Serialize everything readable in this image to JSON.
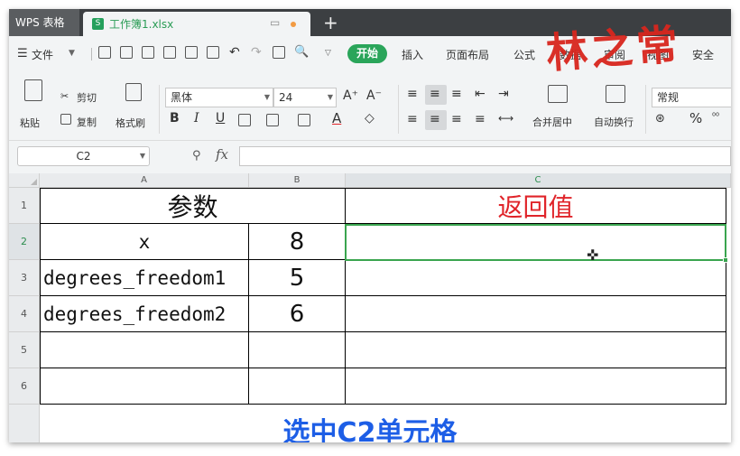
{
  "tabbar": {
    "app_label": "WPS 表格",
    "file_name": "工作簿1.xlsx",
    "plus": "+"
  },
  "menubar": {
    "file": "文件",
    "tabs": [
      "开始",
      "插入",
      "页面布局",
      "公式",
      "数据",
      "审阅",
      "视图",
      "安全"
    ]
  },
  "ribbon": {
    "paste": "粘贴",
    "cut": "剪切",
    "copy": "复制",
    "format_painter": "格式刷",
    "font_name": "黑体",
    "font_size": "24",
    "bold": "B",
    "italic": "I",
    "underline": "U",
    "grow_font": "A⁺",
    "shrink_font": "A⁻",
    "merge_center": "合并居中",
    "wrap_text": "自动换行",
    "number_format": "常规",
    "percent": "%"
  },
  "formula_bar": {
    "name_box": "C2",
    "fx": "fx",
    "formula": ""
  },
  "grid": {
    "columns": [
      "A",
      "B",
      "C"
    ],
    "rows": [
      "1",
      "2",
      "3",
      "4",
      "5",
      "6"
    ],
    "header_param": "参数",
    "header_return": "返回值",
    "rows_data": [
      {
        "label": "x",
        "value": "8"
      },
      {
        "label": "degrees_freedom1",
        "value": "5"
      },
      {
        "label": "degrees_freedom2",
        "value": "6"
      }
    ],
    "selected_cell": "C2"
  },
  "caption": "选中C2单元格",
  "watermark": "林之常",
  "colors": {
    "accent_green": "#2aa55a",
    "header_red": "#e0242a",
    "caption_blue": "#1d5ee6"
  }
}
